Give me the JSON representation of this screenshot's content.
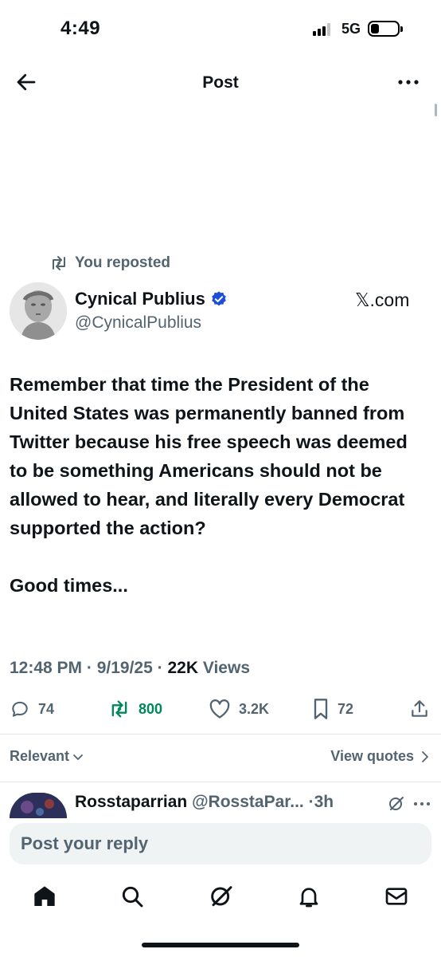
{
  "status_bar": {
    "time": "4:49",
    "network": "5G"
  },
  "header": {
    "title": "Post"
  },
  "repost": {
    "label": "You reposted"
  },
  "author": {
    "name": "Cynical Publius",
    "handle": "@CynicalPublius",
    "source": "𝕏.com"
  },
  "tweet": {
    "text": "Remember that time the President of the United States was permanently banned from Twitter because his free speech was deemed to be something Americans should not be allowed to hear, and literally every Democrat supported the action?\n\nGood times...",
    "time": "12:48 PM",
    "date": "9/19/25",
    "views_count": "22K",
    "views_label": "Views"
  },
  "actions": {
    "replies": "74",
    "reposts": "800",
    "likes": "3.2K",
    "bookmarks": "72"
  },
  "colors": {
    "repost_green": "#00875a",
    "verified_blue": "#1d4ed8",
    "secondary_text": "#536471"
  },
  "sort": {
    "label": "Relevant",
    "view_quotes": "View quotes"
  },
  "reply_preview": {
    "name": "Rosstaparrian",
    "handle": "@RosstaPar...",
    "time": "·3h"
  },
  "composer": {
    "placeholder": "Post your reply"
  },
  "nav": {
    "items": [
      "home-icon",
      "search-icon",
      "grok-icon",
      "notifications-icon",
      "messages-icon"
    ]
  }
}
